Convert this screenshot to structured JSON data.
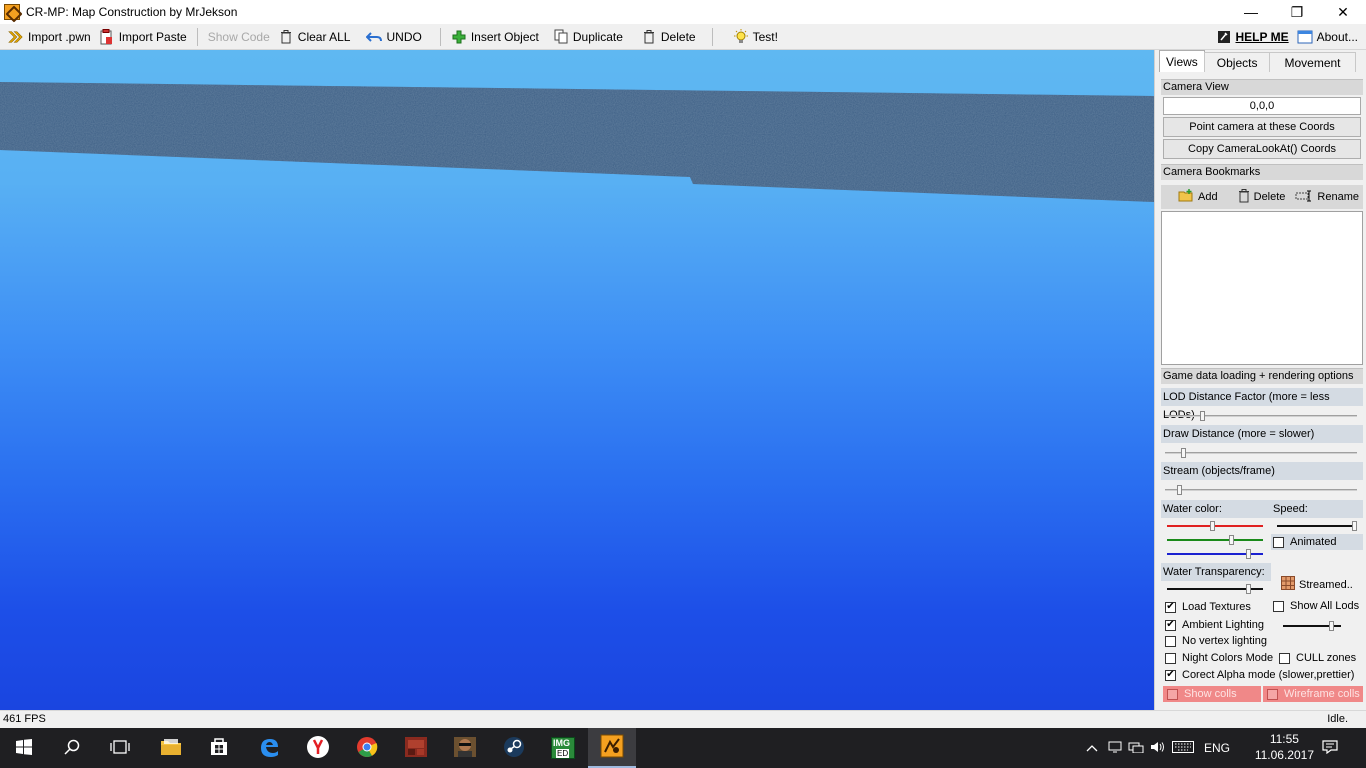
{
  "window": {
    "title": "CR-MP: Map Construction by MrJekson",
    "controls": [
      "—",
      "❐",
      "✕"
    ]
  },
  "toolbar": {
    "import_pwn": "Import .pwn",
    "import_paste": "Import Paste",
    "show_code": "Show Code",
    "clear_all": "Clear ALL",
    "undo": "UNDO",
    "insert_object": "Insert Object",
    "duplicate": "Duplicate",
    "delete": "Delete",
    "test": "Test!",
    "help_me": "HELP ME",
    "about": "About..."
  },
  "panel": {
    "tabs": [
      "Views",
      "Objects",
      "Movement"
    ],
    "active_tab": "Views",
    "camera_view": {
      "header": "Camera View",
      "coords": "0,0,0",
      "point_button": "Point camera at these Coords",
      "copy_button": "Copy CameraLookAt() Coords"
    },
    "bookmarks": {
      "header": "Camera Bookmarks",
      "add": "Add",
      "delete": "Delete",
      "rename": "Rename"
    },
    "options": {
      "header": "Game data loading + rendering options",
      "lod_label": "LOD Distance Factor (more = less LODs)",
      "lod_level": 0.2,
      "draw_label": "Draw Distance (more = slower)",
      "draw_level": 0.1,
      "stream_label": "Stream (objects/frame)",
      "stream_level": 0.08,
      "water_color_label": "Water color:",
      "water_r": 0.48,
      "water_g": 0.68,
      "water_b": 0.85,
      "speed_label": "Speed:",
      "speed_level": 0.98,
      "animated_label": "Animated",
      "animated_checked": false,
      "transparency_label": "Water Transparency:",
      "transparency_level": 0.85,
      "streamed_label": "Streamed..",
      "load_textures": "Load Textures",
      "load_textures_checked": true,
      "show_all_lods": "Show All Lods",
      "show_all_lods_checked": false,
      "ambient_lighting": "Ambient Lighting",
      "ambient_lighting_checked": true,
      "ambient_level": 0.85,
      "no_vertex_lighting": "No vertex lighting",
      "no_vertex_lighting_checked": false,
      "night_colors": "Night Colors Mode",
      "night_colors_checked": false,
      "cull_zones": "CULL zones",
      "cull_zones_checked": false,
      "correct_alpha": "Corect Alpha mode (slower,prettier)",
      "correct_alpha_checked": true,
      "show_colls": "Show colls",
      "show_colls_checked": false,
      "wireframe_colls": "Wireframe colls",
      "wireframe_colls_checked": false
    }
  },
  "status": {
    "fps": "461 FPS",
    "state": "Idle."
  },
  "taskbar": {
    "language": "ENG",
    "time": "11:55",
    "date": "11.06.2017",
    "img_label_1": "IMG",
    "img_label_2": "ED"
  }
}
